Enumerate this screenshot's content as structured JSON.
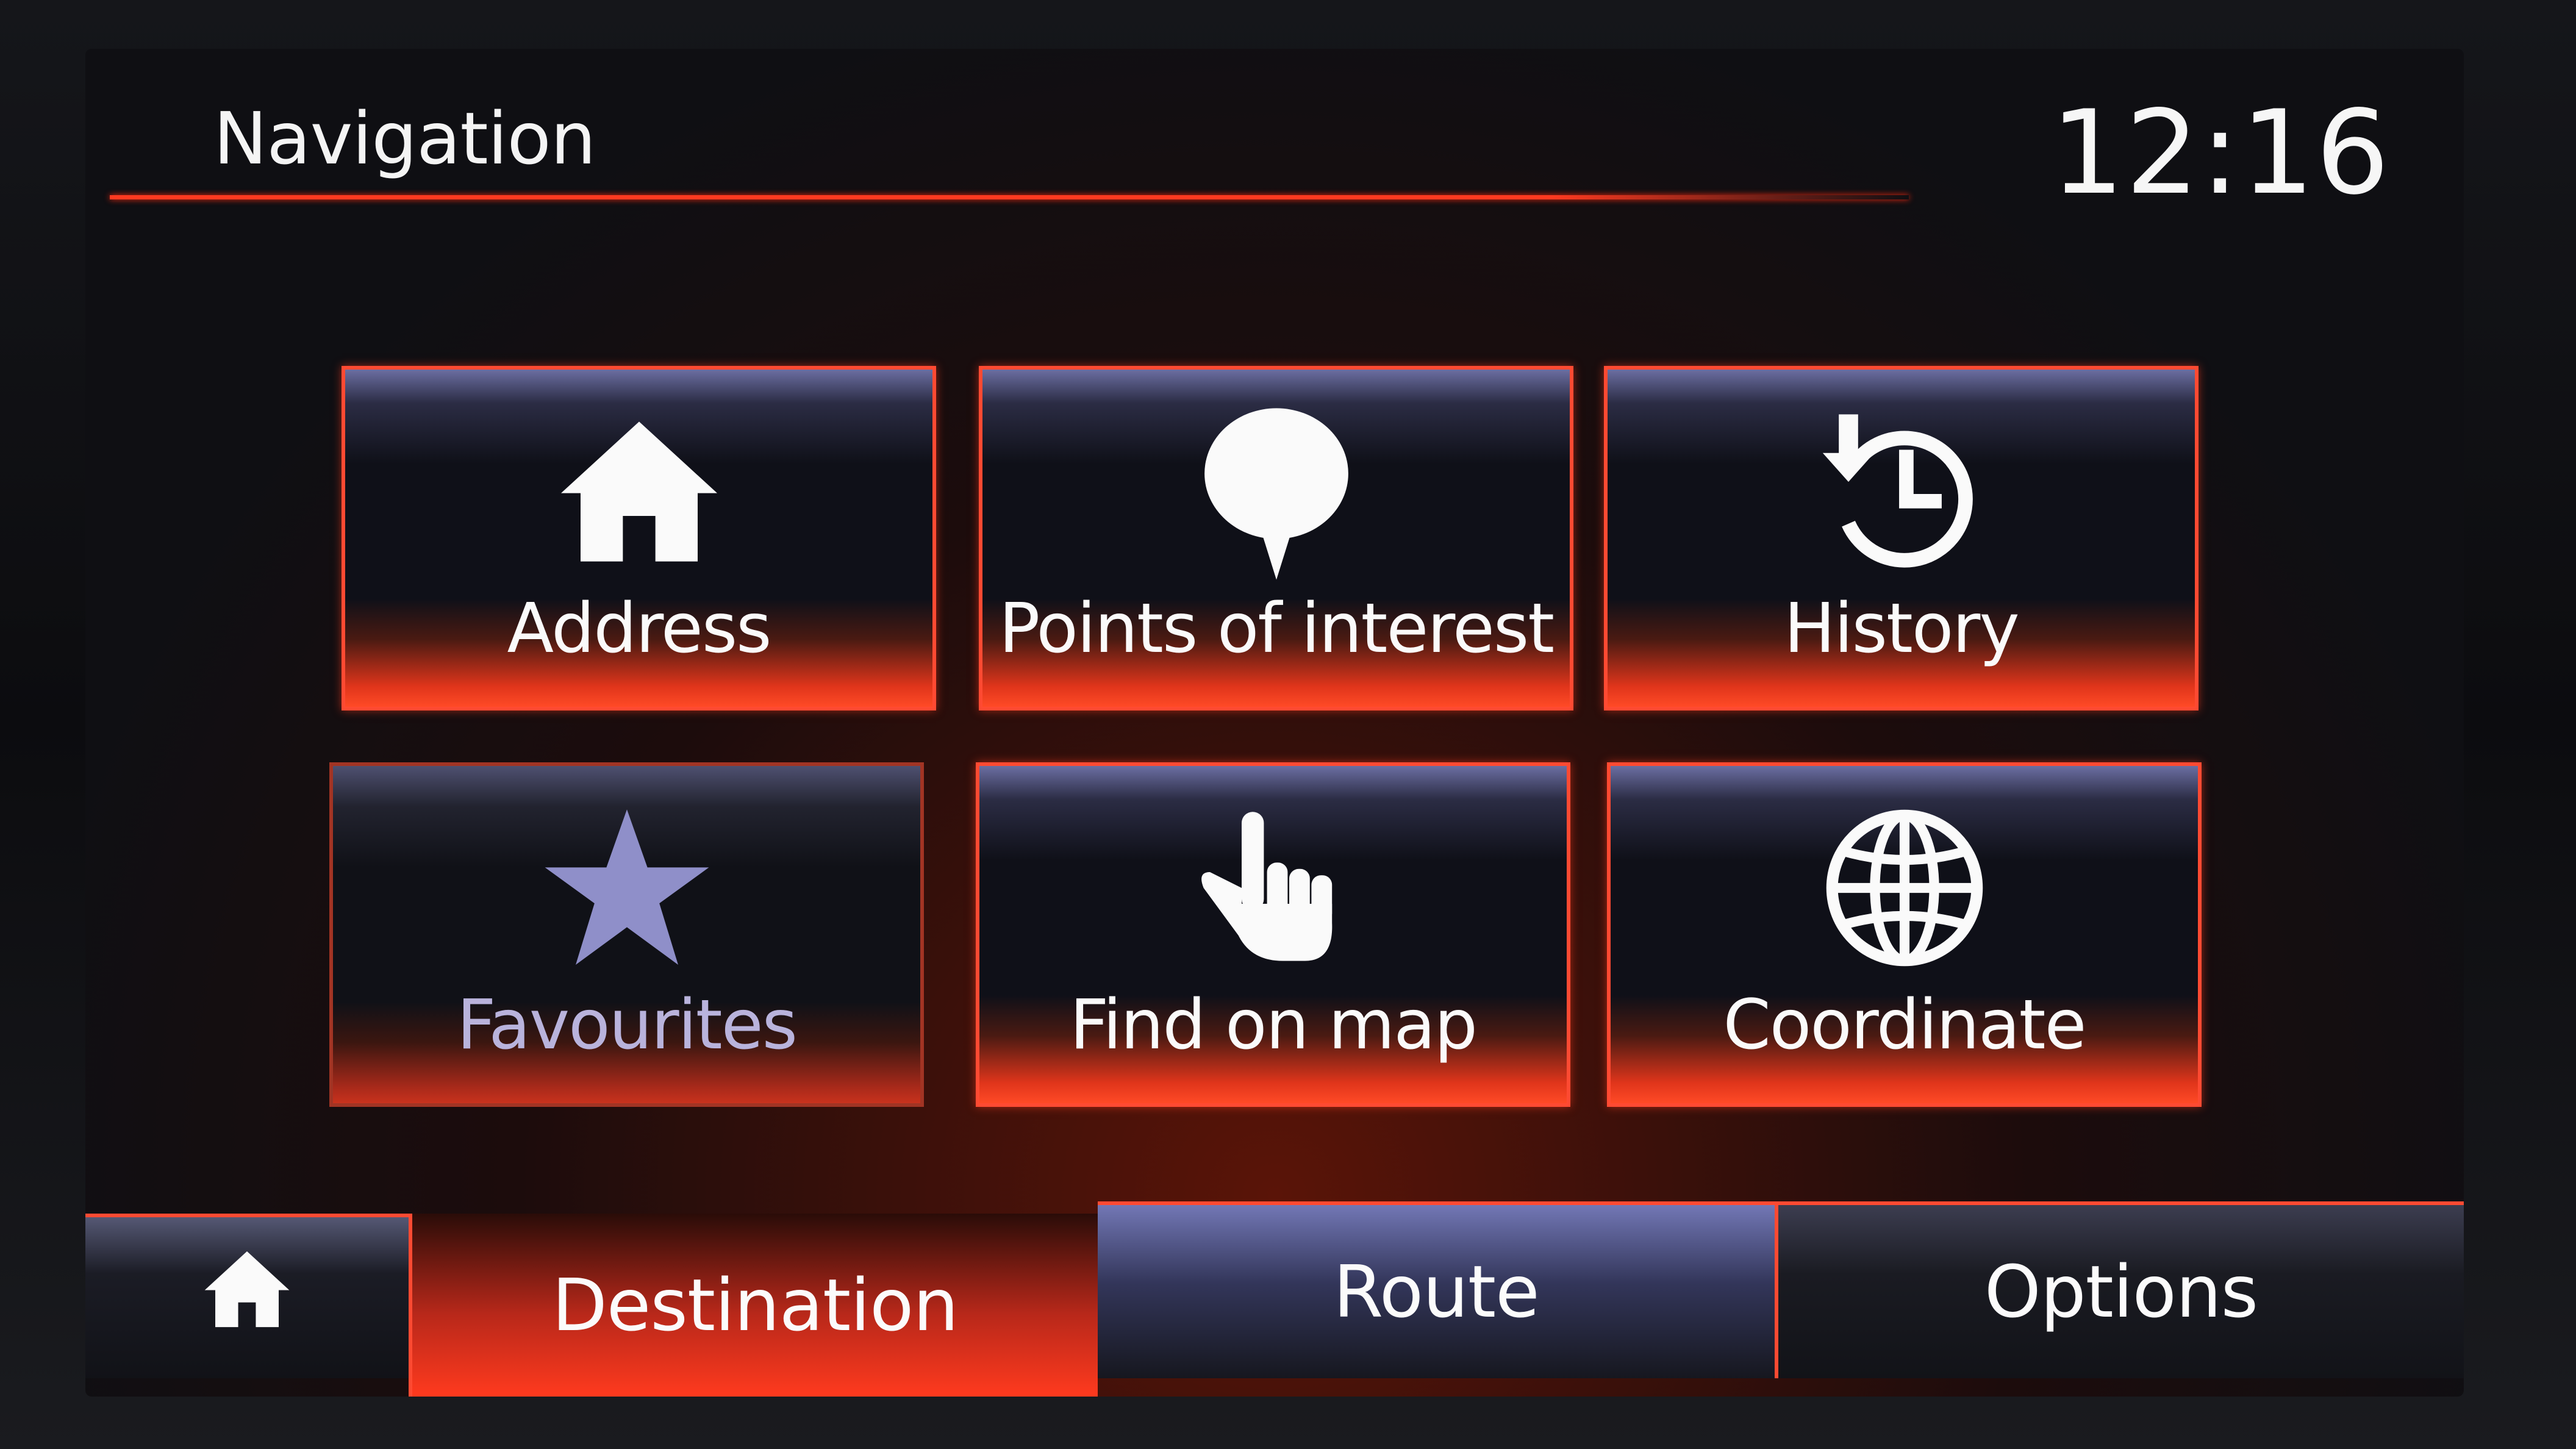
{
  "header": {
    "title": "Navigation",
    "clock": "12:16"
  },
  "tiles": [
    {
      "label": "Address",
      "icon": "home-icon",
      "enabled": true
    },
    {
      "label": "Points of interest",
      "icon": "poi-pin-icon",
      "enabled": true
    },
    {
      "label": "History",
      "icon": "history-clock-icon",
      "enabled": true
    },
    {
      "label": "Favourites",
      "icon": "star-icon",
      "enabled": false
    },
    {
      "label": "Find on map",
      "icon": "pointing-hand-icon",
      "enabled": true
    },
    {
      "label": "Coordinate",
      "icon": "globe-icon",
      "enabled": true
    }
  ],
  "tabs": {
    "home_icon": "home-icon",
    "destination": "Destination",
    "route": "Route",
    "options": "Options",
    "active": "Destination"
  },
  "colors": {
    "accent": "#ff4a32",
    "background": "#0f1018",
    "text": "#fafafa",
    "disabled_text": "#b9b3dc"
  }
}
